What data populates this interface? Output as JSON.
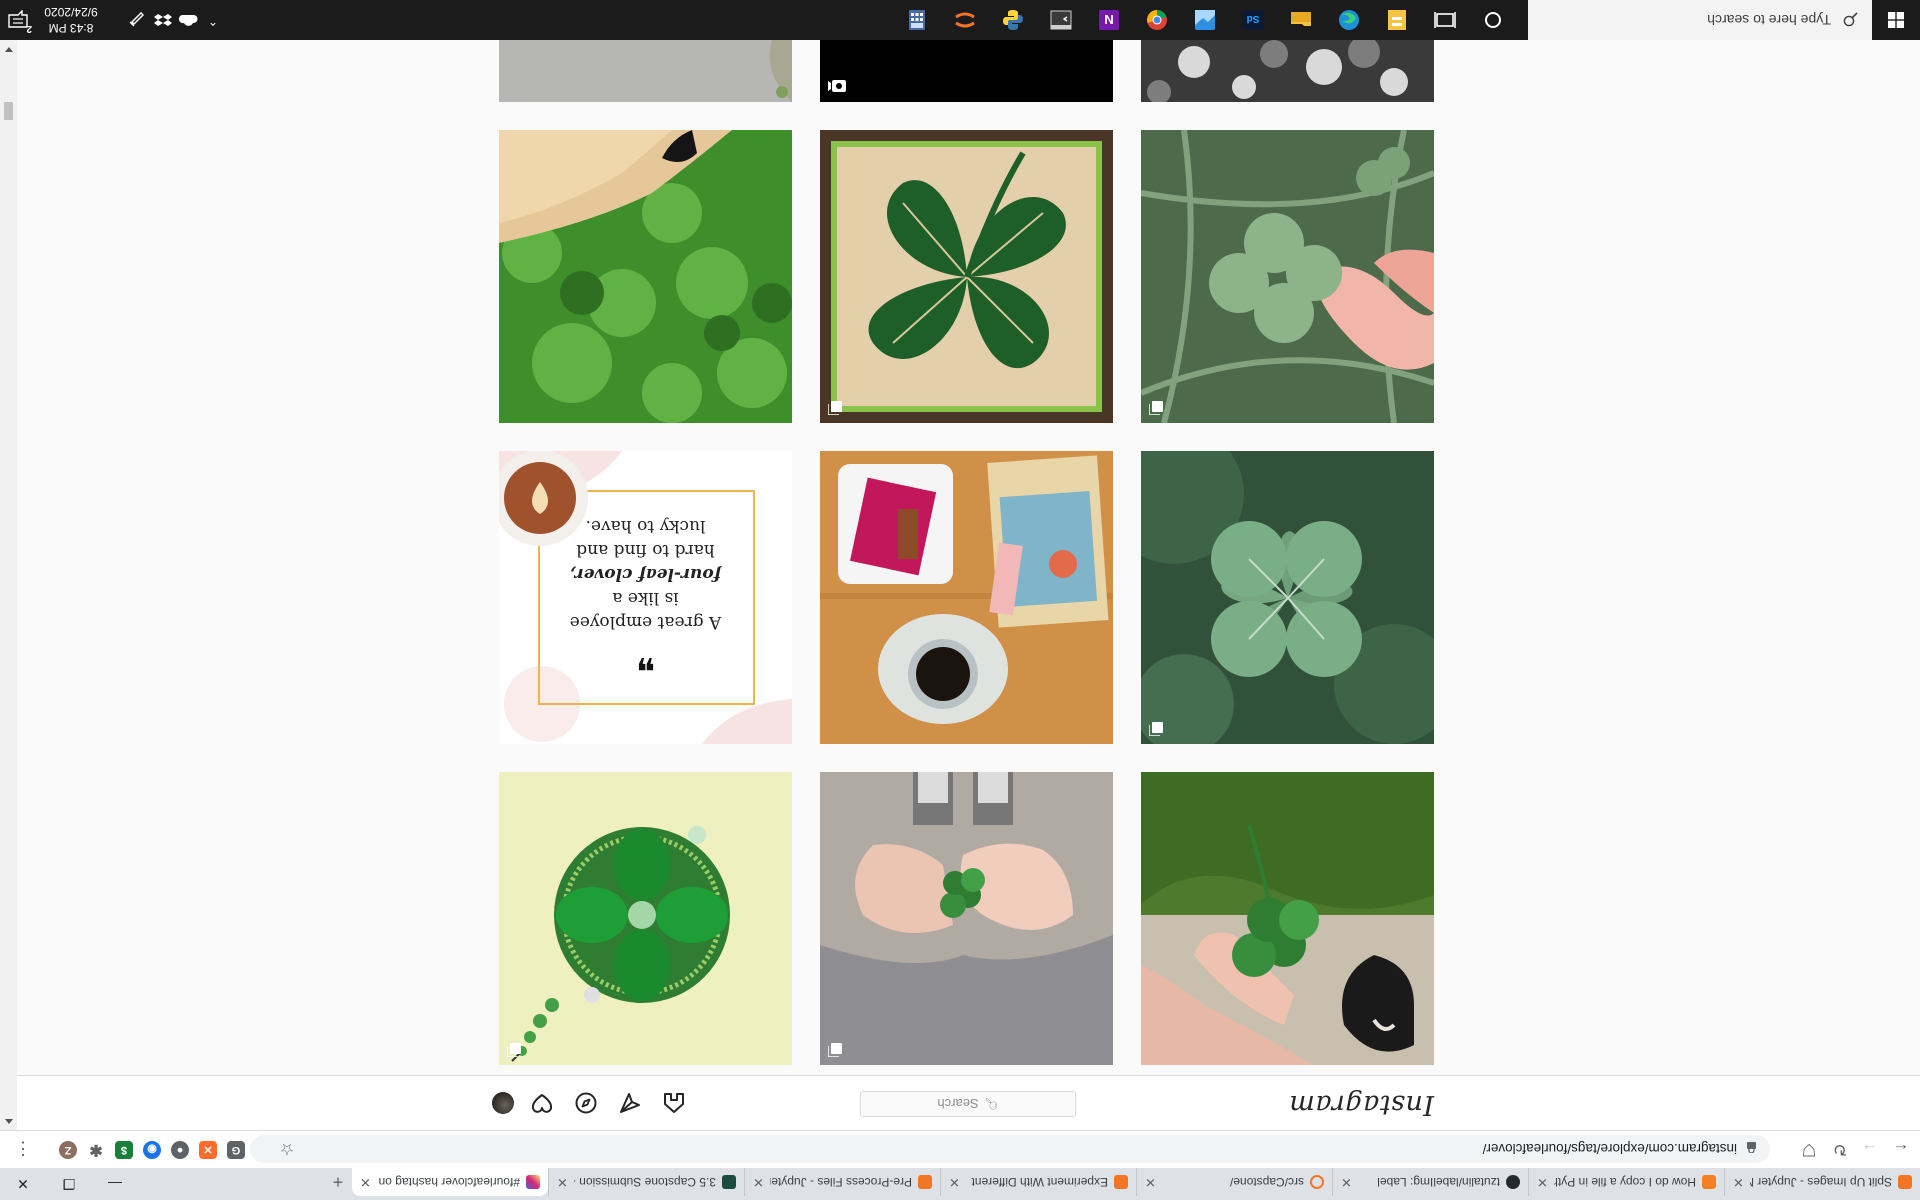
{
  "browser": {
    "tabs": [
      {
        "label": "Split Up Images - Jupyter N",
        "favicon_color": "#f37626",
        "active": false
      },
      {
        "label": "How do I copy a file in Pyth",
        "favicon_color": "#f48024",
        "active": false
      },
      {
        "label": "tzutalin/labelImg: Label",
        "favicon_color": "#24292e",
        "active": false
      },
      {
        "label": "src/Capstone/",
        "favicon_color": "#f37626",
        "active": false
      },
      {
        "label": "Experiment With Different",
        "favicon_color": "#f37626",
        "active": false
      },
      {
        "label": "Pre-Process Files - Jupyter",
        "favicon_color": "#f37626",
        "active": false
      },
      {
        "label": "3.5 Capstone Submission - ",
        "favicon_color": "#1b4d3e",
        "active": false
      },
      {
        "label": "#fourleafclover hashtag on",
        "favicon_color": "#d62976",
        "active": true
      }
    ],
    "new_tab_symbol": "+",
    "url": "instagram.com/explore/tags/fourleafclover/",
    "extensions": [
      {
        "name": "g-extension",
        "color": "#5f6368",
        "glyph": "G"
      },
      {
        "name": "orange-extension",
        "color": "#ff6d2d",
        "glyph": "✕"
      },
      {
        "name": "circle-extension",
        "color": "#5f6368",
        "glyph": "●"
      },
      {
        "name": "blue-extension",
        "color": "#1a73e8",
        "glyph": "◉"
      },
      {
        "name": "money-extension",
        "color": "#188038",
        "glyph": "$"
      },
      {
        "name": "puzzle-extension",
        "color": "#5f6368",
        "glyph": "✱"
      }
    ],
    "profile_initial": "Z"
  },
  "instagram": {
    "logo": "Instagram",
    "search_placeholder": "Search",
    "posts": [
      {
        "id": "post-1",
        "kind": "partial-top",
        "theme": "blurred-grey",
        "badge": "none"
      },
      {
        "id": "post-2",
        "kind": "partial-top",
        "theme": "black-video",
        "badge": "video"
      },
      {
        "id": "post-3",
        "kind": "partial-top",
        "theme": "bw-grass",
        "badge": "none"
      },
      {
        "id": "post-4",
        "kind": "photo",
        "theme": "dog-paw-clover",
        "badge": "none"
      },
      {
        "id": "post-5",
        "kind": "photo",
        "theme": "string-art-clover",
        "badge": "multiple"
      },
      {
        "id": "post-6",
        "kind": "photo",
        "theme": "hand-clover-grass",
        "badge": "multiple"
      },
      {
        "id": "post-7",
        "kind": "quote",
        "theme": "quote-card",
        "badge": "none"
      },
      {
        "id": "post-8",
        "kind": "photo",
        "theme": "coffee-snack-table",
        "badge": "none"
      },
      {
        "id": "post-9",
        "kind": "photo",
        "theme": "clover-closeup",
        "badge": "multiple"
      },
      {
        "id": "post-10",
        "kind": "photo",
        "theme": "beaded-brooch",
        "badge": "multiple"
      },
      {
        "id": "post-11",
        "kind": "photo",
        "theme": "hands-holding-clover",
        "badge": "multiple"
      },
      {
        "id": "post-12",
        "kind": "photo",
        "theme": "hand-clover-dog",
        "badge": "none"
      }
    ],
    "quote": {
      "mark": "❞",
      "line1": "A great employee",
      "line2": "is like a",
      "line3": "four-leaf clover,",
      "line4": "hard to find and",
      "line5": "lucky to have."
    }
  },
  "taskbar": {
    "search_placeholder": "Type here to search",
    "time": "8:43 PM",
    "date": "9/24/2020",
    "notification_count": "2",
    "apps": [
      {
        "name": "cortana-icon",
        "color": "#ffffff"
      },
      {
        "name": "task-view-icon",
        "color": "#ffffff"
      },
      {
        "name": "file-manager-icon",
        "color": "#f4c542"
      },
      {
        "name": "edge-icon",
        "color": "#1e90d8"
      },
      {
        "name": "file-explorer-icon",
        "color": "#f3c13a"
      },
      {
        "name": "photoshop-icon",
        "color": "#26a0ff"
      },
      {
        "name": "app-blue-icon",
        "color": "#2d8fe2"
      },
      {
        "name": "chrome-icon",
        "color": "#4285f4"
      },
      {
        "name": "onenote-icon",
        "color": "#7719aa"
      },
      {
        "name": "terminal-icon",
        "color": "#3a3a3a"
      },
      {
        "name": "python-icon",
        "color": "#3776ab"
      },
      {
        "name": "jupyter-icon",
        "color": "#f37626"
      },
      {
        "name": "calculator-icon",
        "color": "#4a6aa5"
      }
    ],
    "accent": "#76b9ed"
  }
}
